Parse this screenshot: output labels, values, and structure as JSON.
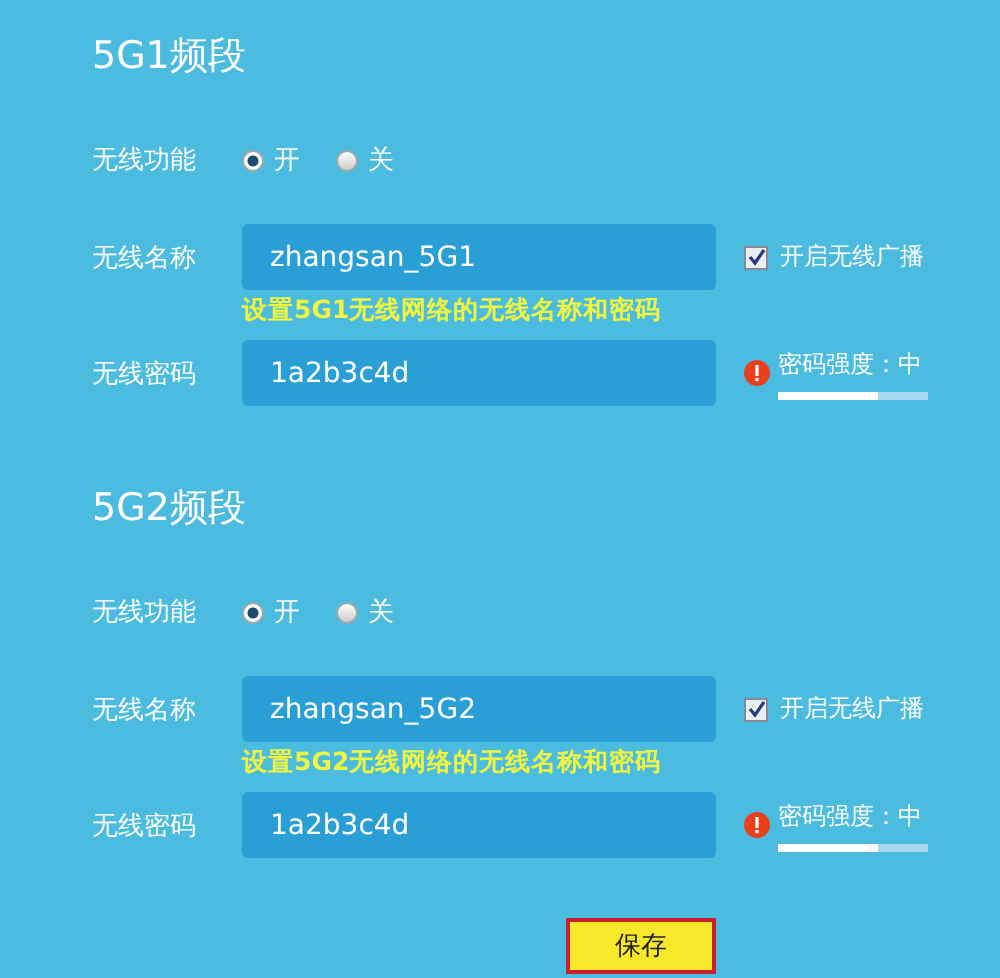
{
  "sections": [
    {
      "title": "5G1频段",
      "wireless": {
        "label": "无线功能",
        "options": [
          {
            "label": "开",
            "selected": true
          },
          {
            "label": "关",
            "selected": false
          }
        ]
      },
      "name": {
        "label": "无线名称",
        "value": "zhangsan_5G1",
        "broadcast": {
          "label": "开启无线广播",
          "checked": true
        }
      },
      "annotation": "设置5G1无线网络的无线名称和密码",
      "password": {
        "label": "无线密码",
        "value": "1a2b3c4d",
        "strength": {
          "label": "密码强度：中",
          "level": 0.67
        }
      }
    },
    {
      "title": "5G2频段",
      "wireless": {
        "label": "无线功能",
        "options": [
          {
            "label": "开",
            "selected": true
          },
          {
            "label": "关",
            "selected": false
          }
        ]
      },
      "name": {
        "label": "无线名称",
        "value": "zhangsan_5G2",
        "broadcast": {
          "label": "开启无线广播",
          "checked": true
        }
      },
      "annotation": "设置5G2无线网络的无线名称和密码",
      "password": {
        "label": "无线密码",
        "value": "1a2b3c4d",
        "strength": {
          "label": "密码强度：中",
          "level": 0.67
        }
      }
    }
  ],
  "save_button": "保存"
}
